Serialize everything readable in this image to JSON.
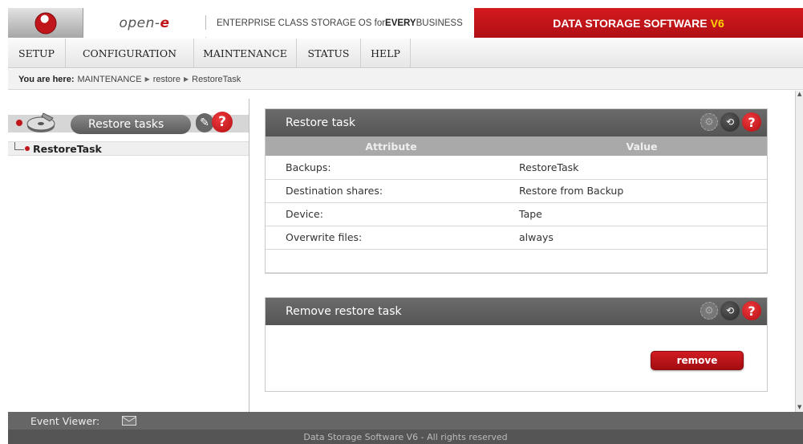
{
  "header": {
    "brand_main": "open-",
    "brand_accent": "e",
    "tagline_prefix": "ENTERPRISE CLASS STORAGE OS for ",
    "tagline_bold": "EVERY",
    "tagline_suffix": " BUSINESS",
    "product": "DATA STORAGE SOFTWARE",
    "version": "V6"
  },
  "menu": {
    "items": [
      {
        "label": "SETUP"
      },
      {
        "label": "CONFIGURATION"
      },
      {
        "label": "MAINTENANCE"
      },
      {
        "label": "STATUS"
      },
      {
        "label": "HELP"
      }
    ]
  },
  "breadcrumb": {
    "prefix": "You are here:",
    "items": [
      "MAINTENANCE",
      "restore",
      "RestoreTask"
    ]
  },
  "left_panel": {
    "title": "Restore tasks",
    "tree_item": "RestoreTask"
  },
  "restore_task_panel": {
    "title": "Restore task",
    "col_attribute": "Attribute",
    "col_value": "Value",
    "rows": [
      {
        "attribute": "Backups:",
        "value": "RestoreTask"
      },
      {
        "attribute": "Destination shares:",
        "value": "Restore from Backup"
      },
      {
        "attribute": "Device:",
        "value": "Tape"
      },
      {
        "attribute": "Overwrite files:",
        "value": "always"
      }
    ]
  },
  "remove_panel": {
    "title": "Remove restore task",
    "button": "remove"
  },
  "footer": {
    "event_viewer": "Event Viewer:",
    "copyright": "Data Storage Software V6 - All rights reserved"
  },
  "colors": {
    "accent_red": "#c0161b",
    "panel_header": "#5f5f5f",
    "table_header": "#a9a9a9"
  }
}
